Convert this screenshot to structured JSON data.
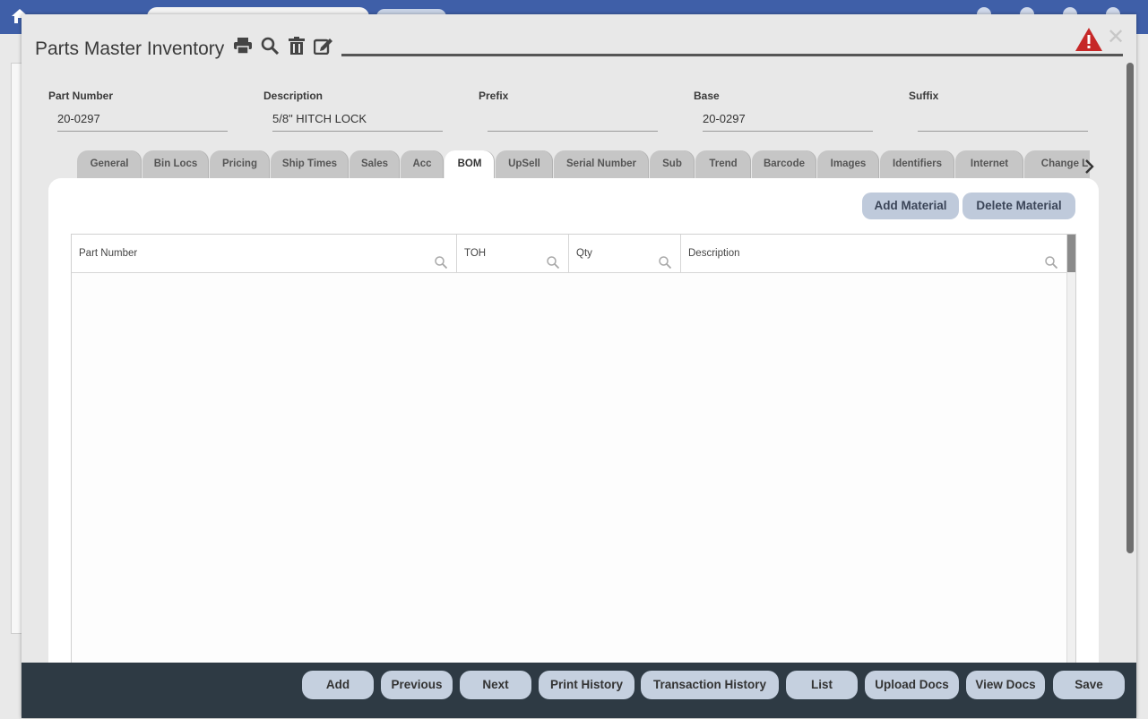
{
  "modal": {
    "title": "Parts Master Inventory",
    "toolbar_icons": [
      "print-icon",
      "search-icon",
      "trash-icon",
      "edit-icon"
    ],
    "alert_color": "#c62828"
  },
  "fields": {
    "part_number": {
      "label": "Part Number",
      "value": "20-0297"
    },
    "description": {
      "label": "Description",
      "value": "5/8\" HITCH LOCK"
    },
    "prefix": {
      "label": "Prefix",
      "value": ""
    },
    "base": {
      "label": "Base",
      "value": "20-0297"
    },
    "suffix": {
      "label": "Suffix",
      "value": ""
    }
  },
  "tabs": [
    "General",
    "Bin Locs",
    "Pricing",
    "Ship Times",
    "Sales",
    "Acc",
    "BOM",
    "UpSell",
    "Serial Number",
    "Sub",
    "Trend",
    "Barcode",
    "Images",
    "Identifiers",
    "Internet",
    "Change L"
  ],
  "active_tab": "BOM",
  "bom": {
    "add_label": "Add Material",
    "delete_label": "Delete Material",
    "columns": [
      "Part Number",
      "TOH",
      "Qty",
      "Description"
    ]
  },
  "footer_buttons": [
    "Add",
    "Previous",
    "Next",
    "Print History",
    "Transaction History",
    "List",
    "Upload Docs",
    "View Docs",
    "Save"
  ],
  "colors": {
    "header": "#3f5fa8",
    "bottombar": "#2e3a44",
    "button": "#c5d0df"
  }
}
